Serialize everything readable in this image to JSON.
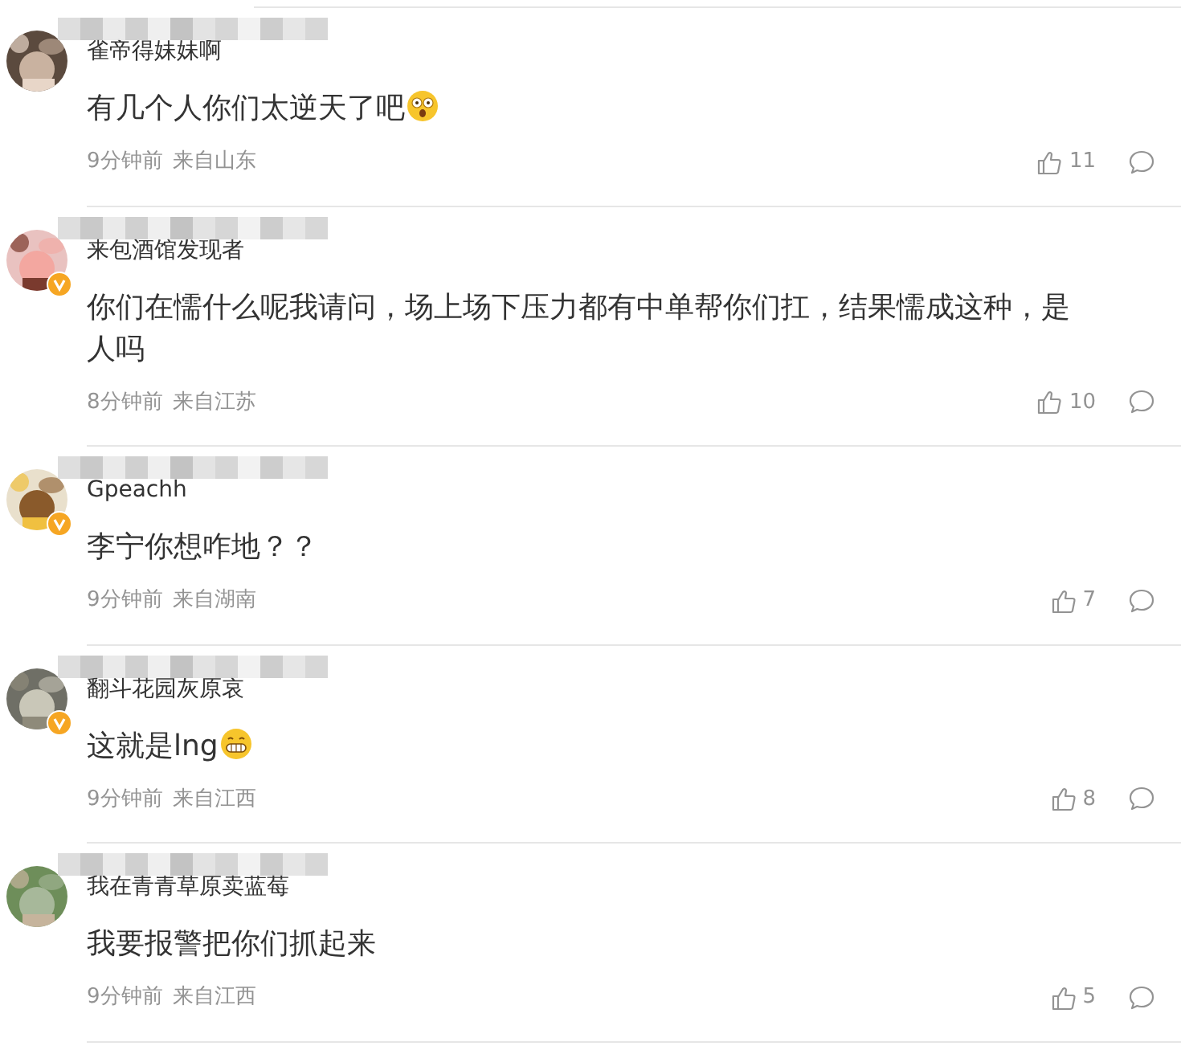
{
  "comments": [
    {
      "username": "雀帝得妹妹啊",
      "verified": false,
      "text": "有几个人你们太逆天了吧",
      "emoji": {
        "kind": "shocked"
      },
      "time": "9分钟前",
      "location": "来自山东",
      "likes": "11"
    },
    {
      "username": "来包酒馆发现者",
      "verified": true,
      "text": "你们在懦什么呢我请问，场上场下压力都有中单帮你们扛，结果懦成这种，是人吗",
      "time": "8分钟前",
      "location": "来自江苏",
      "likes": "10"
    },
    {
      "username": "Gpeachh",
      "verified": true,
      "text": "李宁你想咋地？？",
      "time": "9分钟前",
      "location": "来自湖南",
      "likes": "7"
    },
    {
      "username": "翻斗花园灰原哀",
      "verified": true,
      "text": "这就是lng",
      "emoji": {
        "kind": "grin"
      },
      "time": "9分钟前",
      "location": "来自江西",
      "likes": "8"
    },
    {
      "username": "我在青青草原卖蓝莓",
      "verified": false,
      "text": "我要报警把你们抓起来",
      "time": "9分钟前",
      "location": "来自江西",
      "likes": "5"
    }
  ]
}
